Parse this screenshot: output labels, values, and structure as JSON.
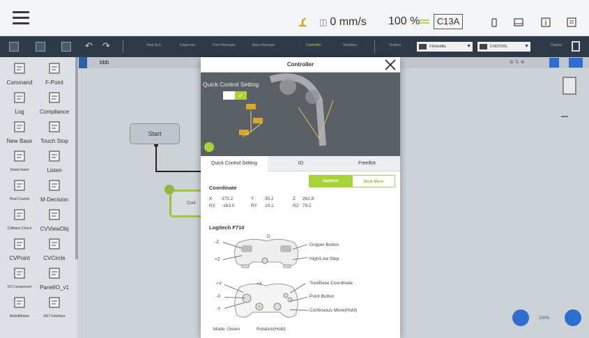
{
  "statusbar": {
    "speed": "0 mm/s",
    "speed_percent": "100 %",
    "controller_id": "C13A"
  },
  "toolbar": {
    "tabs": [
      "Step Run",
      "Diagnosis",
      "Point Manager",
      "Base Manager",
      "Controller",
      "Variables",
      "Toolbox"
    ],
    "active_tab": "Controller",
    "robot_select": "0 RobotBa",
    "tool_select": "0 NOTOOL",
    "display": "Display"
  },
  "leftpanel": {
    "items": [
      {
        "label": "Command",
        "icon": "command-icon"
      },
      {
        "label": "F-Point",
        "icon": "f-point-icon"
      },
      {
        "label": "Log",
        "icon": "log-icon"
      },
      {
        "label": "Compliance",
        "icon": "compliance-icon"
      },
      {
        "label": "New Base",
        "icon": "new-base-icon"
      },
      {
        "label": "Touch Stop",
        "icon": "touch-stop-icon"
      },
      {
        "label": "Smart Insert",
        "icon": "smart-insert-icon"
      },
      {
        "label": "Listen",
        "icon": "listen-icon"
      },
      {
        "label": "Pixel Control",
        "icon": "pixel-control-icon"
      },
      {
        "label": "M-Decision",
        "icon": "m-decision-icon"
      },
      {
        "label": "Collision Check",
        "icon": "collision-icon"
      },
      {
        "label": "CVViewObj",
        "icon": "cv-view-icon"
      },
      {
        "label": "CVPoint",
        "icon": "cv-point-icon"
      },
      {
        "label": "CVCircle",
        "icon": "cv-circle-icon"
      },
      {
        "label": "I/O Component",
        "icon": "io-component-icon"
      },
      {
        "label": "PanelIO_v1",
        "icon": "panel-io-icon"
      },
      {
        "label": "RobotMotion",
        "icon": "robot-motion-icon"
      },
      {
        "label": "AGT Interface",
        "icon": "agt-interface-icon"
      }
    ]
  },
  "canvas": {
    "tab_label": "bbb",
    "start_node": "Start",
    "cont_node": "Cont",
    "zoom": "100%"
  },
  "dialog": {
    "title": "Controller",
    "photo_title": "Quick Control Setting",
    "tabs": [
      "Quick Control Setting",
      "IO",
      "FreeBot"
    ],
    "active_tab": "Quick Control Setting",
    "mode_buttons": [
      "JogStick",
      "Stick Move"
    ],
    "coordinate": {
      "title": "Coordinate",
      "X": "375.2",
      "Y": "30.2",
      "Z": "262.8",
      "RX": "-163.0",
      "RY": "10.1",
      "RZ": "79.2"
    },
    "controller": {
      "title": "Logitech F710",
      "labels_left_top": [
        "-Z",
        "D",
        "+Z"
      ],
      "labels_right_top": [
        "Gripper Button",
        "High/Low Step"
      ],
      "labels_left_bottom": [
        "+Y",
        "+X",
        "-X",
        "-Y"
      ],
      "labels_right_bottom": [
        "Tool/Base Coordinate",
        "Point Button",
        "Continuous Move(Hold)"
      ],
      "footer": [
        "Mode: Green",
        "Rotation(Hold)"
      ]
    }
  },
  "colors": {
    "accent_green": "#a8d43a",
    "toolbar_bg": "#2d3a48",
    "blue": "#2d6fd1"
  }
}
